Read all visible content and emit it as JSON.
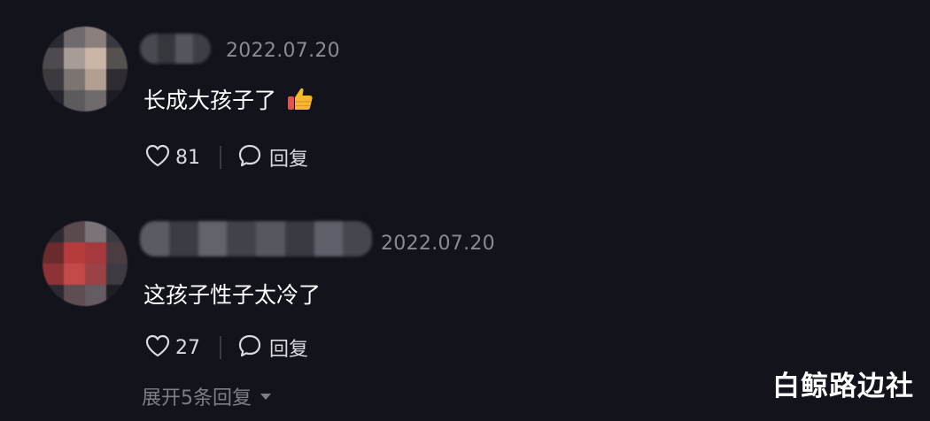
{
  "comments": [
    {
      "timestamp": "2022.07.20",
      "text": "长成大孩子了",
      "emoji": "thumbs-up-emoji",
      "likes": "81",
      "reply_label": "回复"
    },
    {
      "timestamp": "2022.07.20",
      "text": "这孩子性子太冷了",
      "likes": "27",
      "reply_label": "回复",
      "expand_label": "展开5条回复"
    }
  ],
  "watermark": "白鲸路边社",
  "icons": {
    "like": "heart-outline-icon",
    "reply": "speech-bubble-icon",
    "expand": "caret-down-icon"
  },
  "colors": {
    "background": "#13131b",
    "text": "#ffffff",
    "muted": "#8a8a93",
    "action_text": "#d9d9de"
  }
}
